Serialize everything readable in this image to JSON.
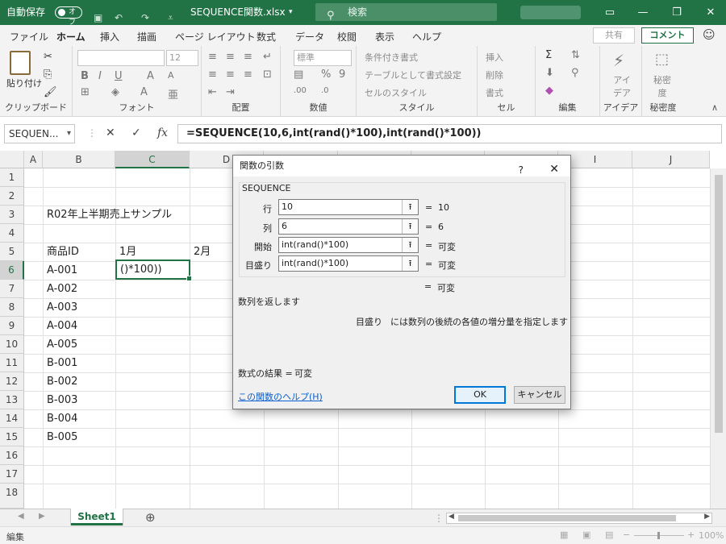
{
  "titlebar": {
    "autosave_label": "自動保存",
    "autosave_state": "オフ",
    "filename": "SEQUENCE関数.xlsx",
    "filename_caret": "▾",
    "search_placeholder": "検索",
    "icons": [
      "save-icon",
      "undo-icon",
      "redo-icon",
      "customize-icon"
    ],
    "win_buttons": [
      "restore-ribbon-icon",
      "minimize-icon",
      "maximize-icon",
      "close-icon"
    ]
  },
  "menu": {
    "tabs": [
      "ファイル",
      "ホーム",
      "挿入",
      "描画",
      "ページ レイアウト",
      "数式",
      "データ",
      "校閲",
      "表示",
      "ヘルプ"
    ],
    "active_tab": "ホーム",
    "share": "共有",
    "comment": "コメント"
  },
  "ribbon": {
    "clipboard": {
      "paste": "貼り付け",
      "label": "クリップボード"
    },
    "font": {
      "size": "12",
      "label": "フォント"
    },
    "alignment": {
      "label": "配置"
    },
    "number": {
      "format": "標準",
      "label": "数値"
    },
    "styles": {
      "conditional": "条件付き書式",
      "table": "テーブルとして書式設定",
      "cell": "セルのスタイル",
      "label": "スタイル"
    },
    "cells": {
      "insert": "挿入",
      "delete": "削除",
      "format": "書式",
      "label": "セル"
    },
    "editing": {
      "label": "編集"
    },
    "ideas": {
      "btn": "アイ デア",
      "label": "アイデア"
    },
    "sensitivity": {
      "btn": "秘密 度",
      "label": "秘密度"
    }
  },
  "formula_bar": {
    "namebox": "SEQUEN...",
    "cancel": "✕",
    "enter": "✓",
    "fx": "fx",
    "formula": "=SEQUENCE(10,6,int(rand()*100),int(rand()*100))"
  },
  "grid": {
    "columns": [
      "A",
      "B",
      "C",
      "D",
      "E",
      "F",
      "G",
      "H",
      "I",
      "J"
    ],
    "rows": [
      "1",
      "2",
      "3",
      "4",
      "5",
      "6",
      "7",
      "8",
      "9",
      "10",
      "11",
      "12",
      "13",
      "14",
      "15",
      "16",
      "17",
      "18"
    ],
    "selected_col": "C",
    "selected_row": "6",
    "cells": {
      "title": "R02年上半期売上サンプル",
      "hdr_id": "商品ID",
      "hdr_m1": "1月",
      "hdr_m2": "2月",
      "ids": [
        "A-001",
        "A-002",
        "A-003",
        "A-004",
        "A-005",
        "B-001",
        "B-002",
        "B-003",
        "B-004",
        "B-005"
      ]
    },
    "active_cell_text": "()*100))"
  },
  "sheets": {
    "active": "Sheet1",
    "add": "⊕"
  },
  "status": {
    "mode": "編集",
    "zoom": "100%",
    "minus": "−",
    "plus": "+"
  },
  "dialog": {
    "title": "関数の引数",
    "help_q": "?",
    "close": "✕",
    "function_name": "SEQUENCE",
    "args": [
      {
        "label": "行",
        "value": "10",
        "result": "10"
      },
      {
        "label": "列",
        "value": "6",
        "result": "6"
      },
      {
        "label": "開始",
        "value": "int(rand()*100)",
        "result": "可変"
      },
      {
        "label": "目盛り",
        "value": "int(rand()*100)",
        "result": "可変"
      }
    ],
    "total_result": "可変",
    "description": "数列を返します",
    "arg_description_name": "目盛り",
    "arg_description": "には数列の後続の各値の増分量を指定します",
    "formula_result_label": "数式の結果 =",
    "formula_result": "可変",
    "help_link": "この関数のヘルプ(H)",
    "ok": "OK",
    "cancel": "キャンセル",
    "equals": "="
  }
}
